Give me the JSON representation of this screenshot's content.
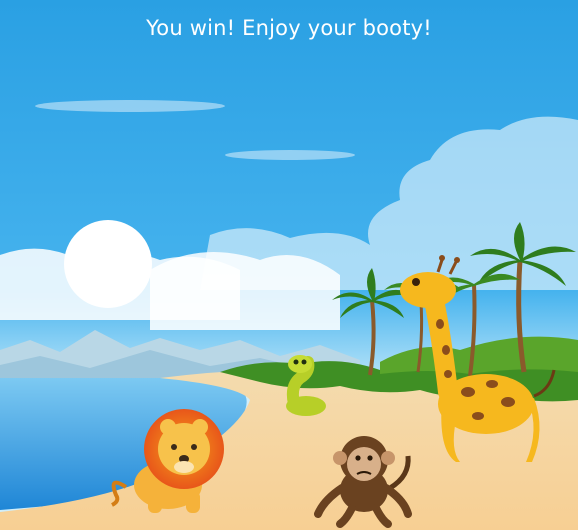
{
  "game": {
    "message": "You win! Enjoy your booty!"
  },
  "scene": {
    "sky_color": "#2ea3e3",
    "sun_color": "#ffffff",
    "sea_color": "#3aa9ea",
    "sand_color": "#f6d7a2",
    "characters": [
      {
        "name": "lion",
        "role": "animal"
      },
      {
        "name": "snake",
        "role": "animal"
      },
      {
        "name": "monkey",
        "role": "animal"
      },
      {
        "name": "giraffe",
        "role": "animal"
      }
    ]
  }
}
